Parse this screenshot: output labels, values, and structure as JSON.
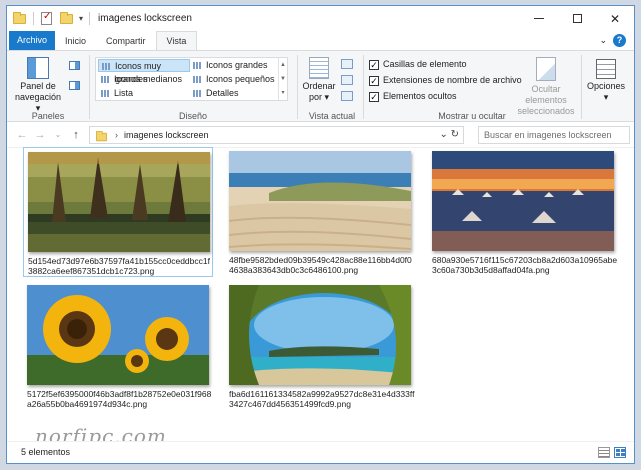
{
  "window": {
    "title": "imagenes lockscreen",
    "minimize": "—",
    "maximize": "☐",
    "close": "✕"
  },
  "tabs": [
    {
      "label": "Archivo"
    },
    {
      "label": "Inicio"
    },
    {
      "label": "Compartir"
    },
    {
      "label": "Vista"
    }
  ],
  "ribbon": {
    "paneles": {
      "nav_pane_label": "Panel de navegación",
      "nav_pane_caret": "▾",
      "group_label": "Paneles"
    },
    "diseno": {
      "items": [
        {
          "label": "Iconos muy grandes",
          "selected": true
        },
        {
          "label": "Iconos grandes",
          "selected": false
        },
        {
          "label": "Iconos medianos",
          "selected": false
        },
        {
          "label": "Iconos pequeños",
          "selected": false
        },
        {
          "label": "Lista",
          "selected": false
        },
        {
          "label": "Detalles",
          "selected": false
        }
      ],
      "group_label": "Diseño"
    },
    "vista_actual": {
      "sort_label": "Ordenar por",
      "sort_caret": "▾",
      "group_label": "Vista actual"
    },
    "mostrar": {
      "checkboxes": [
        {
          "label": "Casillas de elemento",
          "checked": true
        },
        {
          "label": "Extensiones de nombre de archivo",
          "checked": true
        },
        {
          "label": "Elementos ocultos",
          "checked": true
        }
      ],
      "hide_selected_label": "Ocultar elementos seleccionados",
      "group_label": "Mostrar u ocultar"
    },
    "opciones": {
      "label": "Opciones",
      "caret": "▾"
    }
  },
  "address": {
    "path": "imagenes lockscreen",
    "search_placeholder": "Buscar en imagenes lockscreen"
  },
  "files": [
    {
      "name": "5d154ed73d97e6b37597fa41b155cc0ceddbcc1f3882ca6eef867351dcb1c723.png",
      "image": "cypress-swamp",
      "selected": true
    },
    {
      "name": "48fbe9582bded09b39549c428ac88e116bb4d0f04638a383643db0c3c6486100.png",
      "image": "sand-dunes-beach",
      "selected": false
    },
    {
      "name": "680a930e5716f115c67203cb8a2d603a10965abe3c60a730b3d5d8affad04fa.png",
      "image": "salt-flats-sunset",
      "selected": false
    },
    {
      "name": "5172f5ef6395000f46b3adf8f1b28752e0e031f968a26a55b0ba4691974d934c.png",
      "image": "sunflowers",
      "selected": false
    },
    {
      "name": "fba6d161161334582a9992a9527dc8e31e4d333ff3427c467dd456351499fcd9.png",
      "image": "tropical-beach-cave",
      "selected": false
    }
  ],
  "watermark": "norfipc.com",
  "status": {
    "count": "5 elementos"
  },
  "colors": {
    "accent": "#1979ca",
    "selection": "#cce4f7"
  }
}
